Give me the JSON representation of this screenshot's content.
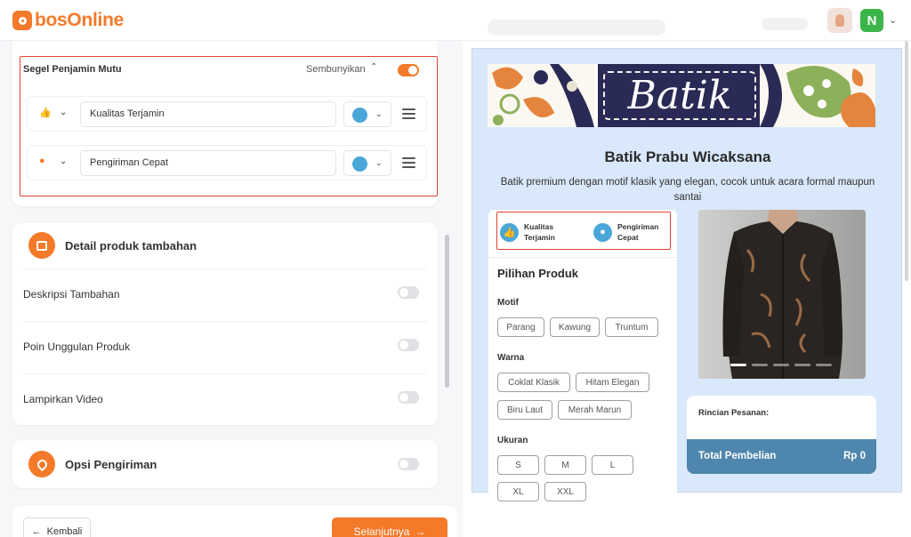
{
  "app": {
    "logo_text": "bosOnline"
  },
  "header": {
    "avatar_initial": "N"
  },
  "seal_section": {
    "title": "Segel Penjamin Mutu",
    "hide_label": "Sembunyikan",
    "enabled": true,
    "items": [
      {
        "icon": "thumbs-up-icon",
        "value": "Kualitas Terjamin",
        "color": "#4aa7d8"
      },
      {
        "icon": "delivery-scooter-icon",
        "value": "Pengiriman Cepat",
        "color": "#4aa7d8"
      }
    ]
  },
  "detail_section": {
    "title": "Detail produk tambahan",
    "options": [
      {
        "label": "Deskripsi Tambahan",
        "enabled": false
      },
      {
        "label": "Poin Unggulan Produk",
        "enabled": false
      },
      {
        "label": "Lampirkan Video",
        "enabled": false
      }
    ]
  },
  "shipping_section": {
    "title": "Opsi Pengiriman",
    "enabled": false
  },
  "footer": {
    "back_label": "Kembali",
    "next_label": "Selanjutnya"
  },
  "preview": {
    "banner_text": "Batik",
    "shop_name": "Batik Prabu Wicaksana",
    "description": "Batik premium dengan motif klasik yang elegan, cocok untuk acara formal maupun santai",
    "seal_badges": [
      {
        "icon": "thumbs-up-icon",
        "line1": "Kualitas",
        "line2": "Terjamin"
      },
      {
        "icon": "delivery-scooter-icon",
        "line1": "Pengiriman",
        "line2": "Cepat"
      }
    ],
    "product_options_title": "Pilihan Produk",
    "motif": {
      "label": "Motif",
      "options": [
        "Parang",
        "Kawung",
        "Truntum"
      ]
    },
    "warna": {
      "label": "Warna",
      "options": [
        "Coklat Klasik",
        "Hitam Elegan",
        "Biru Laut",
        "Merah Marun"
      ]
    },
    "ukuran": {
      "label": "Ukuran",
      "options": [
        "S",
        "M",
        "L",
        "XL",
        "XXL"
      ]
    },
    "order_summary_label": "Rincian Pesanan:",
    "total_label": "Total Pembelian",
    "total_value": "Rp 0",
    "carousel": {
      "count": 5,
      "active": 0
    }
  },
  "colors": {
    "accent": "#f47a2a",
    "seal_color": "#4aa7d8",
    "highlight_border": "#e0432f",
    "preview_bg": "#d9e8fa",
    "total_bar": "#4f86ad"
  }
}
